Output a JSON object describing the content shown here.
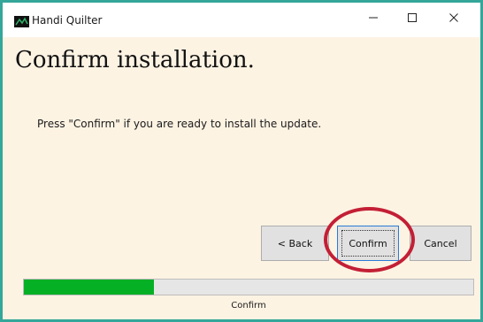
{
  "window": {
    "title": "Handi Quilter",
    "icon": "handi-quilter-app-icon",
    "controls": [
      "minimize-icon",
      "maximize-icon",
      "close-icon"
    ]
  },
  "page": {
    "heading": "Confirm installation.",
    "message": "Press \"Confirm\" if you are ready to install the update."
  },
  "buttons": {
    "back_label": "< Back",
    "confirm_label": "Confirm",
    "cancel_label": "Cancel"
  },
  "progress": {
    "fraction": 0.29,
    "label": "Confirm"
  },
  "colors": {
    "frame_border": "#35a69a",
    "background": "#fdf3e3",
    "progress_fill": "#06b025",
    "highlight_ring": "#c31f35"
  }
}
